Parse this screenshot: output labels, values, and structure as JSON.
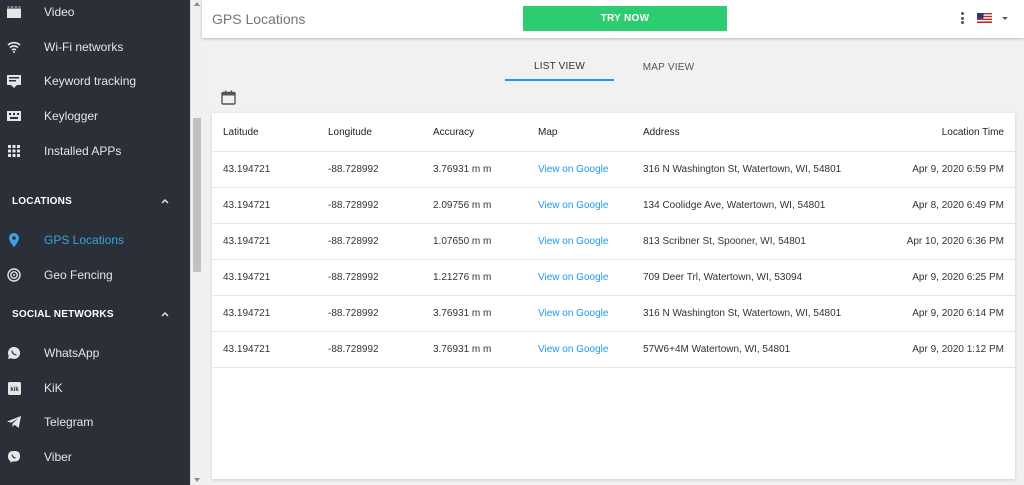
{
  "sidebar": {
    "items_top": [
      {
        "label": "Video",
        "icon": "video-icon"
      },
      {
        "label": "Wi-Fi networks",
        "icon": "wifi-icon"
      },
      {
        "label": "Keyword tracking",
        "icon": "keyword-icon"
      },
      {
        "label": "Keylogger",
        "icon": "keyboard-icon"
      },
      {
        "label": "Installed APPs",
        "icon": "grid-icon"
      }
    ],
    "locations_section": "LOCATIONS",
    "locations_items": [
      {
        "label": "GPS Locations",
        "icon": "location-pin-icon"
      },
      {
        "label": "Geo Fencing",
        "icon": "target-icon"
      }
    ],
    "social_section": "SOCIAL NETWORKS",
    "social_items": [
      {
        "label": "WhatsApp",
        "icon": "whatsapp-icon"
      },
      {
        "label": "KiK",
        "icon": "kik-icon"
      },
      {
        "label": "Telegram",
        "icon": "telegram-icon"
      },
      {
        "label": "Viber",
        "icon": "viber-icon"
      }
    ],
    "active_color": "#3aa3e3"
  },
  "header": {
    "title": "GPS Locations",
    "try_label": "TRY NOW",
    "try_color": "#2ecc71"
  },
  "tabs": {
    "list": "LIST VIEW",
    "map": "MAP VIEW"
  },
  "table": {
    "headers": {
      "latitude": "Latitude",
      "longitude": "Longitude",
      "accuracy": "Accuracy",
      "map": "Map",
      "address": "Address",
      "time": "Location Time"
    },
    "rows": [
      {
        "lat": "43.194721",
        "lng": "-88.728992",
        "acc": "3.76931 m m",
        "map": "View on Google",
        "addr": "316 N Washington St, Watertown, WI, 54801",
        "time": "Apr 9, 2020 6:59 PM"
      },
      {
        "lat": "43.194721",
        "lng": "-88.728992",
        "acc": "2.09756 m m",
        "map": "View on Google",
        "addr": "134 Coolidge Ave, Watertown, WI, 54801",
        "time": "Apr 8, 2020 6:49 PM"
      },
      {
        "lat": "43.194721",
        "lng": "-88.728992",
        "acc": "1.07650 m m",
        "map": "View on Google",
        "addr": "813 Scribner St, Spooner, WI, 54801",
        "time": "Apr 10, 2020 6:36 PM"
      },
      {
        "lat": "43.194721",
        "lng": "-88.728992",
        "acc": "1.21276 m m",
        "map": "View on Google",
        "addr": "709 Deer Trl, Watertown, WI, 53094",
        "time": "Apr 9, 2020 6:25 PM"
      },
      {
        "lat": "43.194721",
        "lng": "-88.728992",
        "acc": "3.76931 m m",
        "map": "View on Google",
        "addr": "316 N Washington St, Watertown, WI, 54801",
        "time": "Apr 9, 2020 6:14 PM"
      },
      {
        "lat": "43.194721",
        "lng": "-88.728992",
        "acc": "3.76931 m m",
        "map": "View on Google",
        "addr": "57W6+4M Watertown, WI, 54801",
        "time": "Apr 9, 2020 1:12 PM"
      }
    ]
  }
}
